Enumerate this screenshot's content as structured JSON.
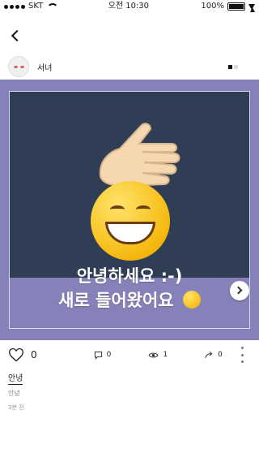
{
  "status_bar": {
    "carrier": "SKT",
    "time": "오전 10:30",
    "battery_percent": "100%"
  },
  "author": {
    "name": "서녀"
  },
  "post": {
    "overlay_line1": "안녕하세요 :-)",
    "overlay_line2": "새로 들어왔어요",
    "title": "안녕",
    "body": "안녕",
    "time_ago": "3분 전"
  },
  "stats": {
    "likes": "0",
    "comments": "0",
    "views": "1",
    "shares": "0"
  },
  "icons": {
    "back": "back-chevron-icon",
    "more": "more-options-icon",
    "next": "chevron-right-icon",
    "like": "heart-icon",
    "comment": "comment-icon",
    "views": "eye-icon",
    "share": "share-icon",
    "post_menu": "kebab-icon",
    "hand": "raised-hand-emoji",
    "face": "grinning-face-emoji",
    "smile": "smiling-face-emoji"
  },
  "colors": {
    "media_background": "#8781b9",
    "media_photo_background": "#2f3e55",
    "text_primary": "#222222",
    "text_secondary": "#888888"
  }
}
